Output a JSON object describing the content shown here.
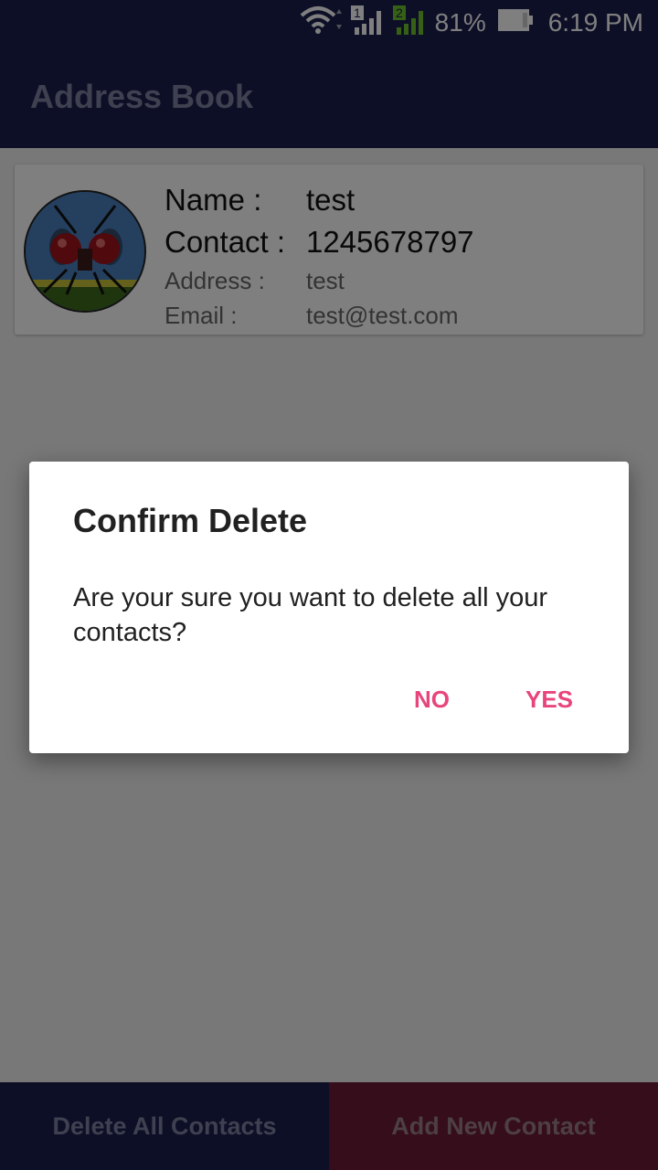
{
  "status": {
    "battery": "81%",
    "time": "6:19 PM"
  },
  "app": {
    "title": "Address Book"
  },
  "contact": {
    "name_label": "Name :",
    "name": "test",
    "contact_label": "Contact :",
    "contact": "1245678797",
    "address_label": "Address :",
    "address": "test",
    "email_label": "Email :",
    "email": "test@test.com"
  },
  "bottom": {
    "delete_all": "Delete All Contacts",
    "add_new": "Add New Contact"
  },
  "dialog": {
    "title": "Confirm Delete",
    "message": "Are your sure you want to delete all your contacts?",
    "no": "NO",
    "yes": "YES"
  },
  "colors": {
    "primary": "#1a1f4e",
    "accent": "#e8457b",
    "add_button": "#6b1a37"
  }
}
